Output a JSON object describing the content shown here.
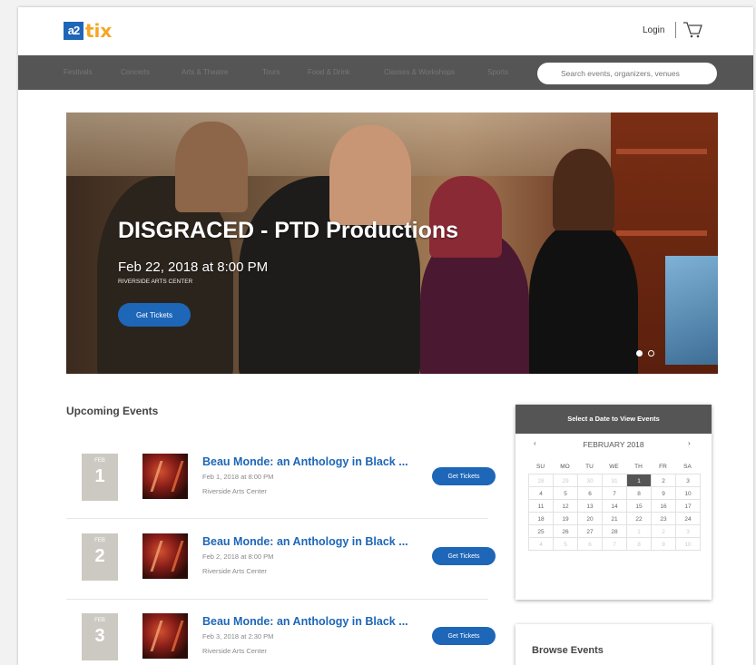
{
  "brand": {
    "logo_mark": "a2",
    "logo_text": "tix"
  },
  "header": {
    "login": "Login",
    "cart_icon": "cart-icon"
  },
  "nav": {
    "items": [
      "Festivals",
      "Concerts",
      "Arts & Theatre",
      "Tours",
      "Food & Drink",
      "Classes & Workshops",
      "Sports"
    ],
    "search_placeholder": "Search events, organizers, venues"
  },
  "hero": {
    "title": "DISGRACED - PTD Productions",
    "date": "Feb 22, 2018 at 8:00 PM",
    "venue": "RIVERSIDE ARTS CENTER",
    "button": "Get Tickets"
  },
  "upcoming": {
    "heading": "Upcoming Events",
    "events": [
      {
        "month": "FEB",
        "day": "1",
        "title": "Beau Monde: an Anthology in Black ...",
        "date": "Feb 1, 2018 at 8:00 PM",
        "venue": "Riverside Arts Center",
        "button": "Get Tickets"
      },
      {
        "month": "FEB",
        "day": "2",
        "title": "Beau Monde: an Anthology in Black ...",
        "date": "Feb 2, 2018 at 8:00 PM",
        "venue": "Riverside Arts Center",
        "button": "Get Tickets"
      },
      {
        "month": "FEB",
        "day": "3",
        "title": "Beau Monde: an Anthology in Black ...",
        "date": "Feb 3, 2018 at 2:30 PM",
        "venue": "Riverside Arts Center",
        "button": "Get Tickets"
      }
    ]
  },
  "calendar": {
    "header": "Select a Date to View Events",
    "month": "FEBRUARY 2018",
    "prev": "‹",
    "next": "›",
    "dow": [
      "SU",
      "MO",
      "TU",
      "WE",
      "TH",
      "FR",
      "SA"
    ],
    "selected_day": "1",
    "weeks": [
      [
        {
          "d": "28",
          "m": true
        },
        {
          "d": "29",
          "m": true
        },
        {
          "d": "30",
          "m": true
        },
        {
          "d": "31",
          "m": true
        },
        {
          "d": "1"
        },
        {
          "d": "2"
        },
        {
          "d": "3"
        }
      ],
      [
        {
          "d": "4"
        },
        {
          "d": "5"
        },
        {
          "d": "6"
        },
        {
          "d": "7"
        },
        {
          "d": "8"
        },
        {
          "d": "9"
        },
        {
          "d": "10"
        }
      ],
      [
        {
          "d": "11"
        },
        {
          "d": "12"
        },
        {
          "d": "13"
        },
        {
          "d": "14"
        },
        {
          "d": "15"
        },
        {
          "d": "16"
        },
        {
          "d": "17"
        }
      ],
      [
        {
          "d": "18"
        },
        {
          "d": "19"
        },
        {
          "d": "20"
        },
        {
          "d": "21"
        },
        {
          "d": "22"
        },
        {
          "d": "23"
        },
        {
          "d": "24"
        }
      ],
      [
        {
          "d": "25"
        },
        {
          "d": "26"
        },
        {
          "d": "27"
        },
        {
          "d": "28"
        },
        {
          "d": "1",
          "m": true
        },
        {
          "d": "2",
          "m": true
        },
        {
          "d": "3",
          "m": true
        }
      ],
      [
        {
          "d": "4",
          "m": true
        },
        {
          "d": "5",
          "m": true
        },
        {
          "d": "6",
          "m": true
        },
        {
          "d": "7",
          "m": true
        },
        {
          "d": "8",
          "m": true
        },
        {
          "d": "9",
          "m": true
        },
        {
          "d": "10",
          "m": true
        }
      ]
    ]
  },
  "browse": {
    "title": "Browse Events"
  },
  "colors": {
    "accent": "#1d66b8",
    "nav_bg": "#555555",
    "logo_orange": "#f5a623"
  }
}
